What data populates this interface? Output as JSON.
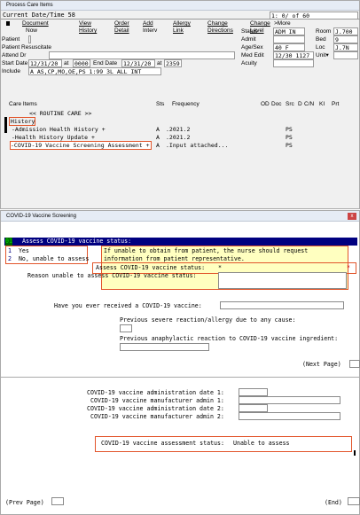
{
  "window1": {
    "title": "Process Care Items",
    "current_label": "Current Date/Time 58",
    "paging": "1: 0/ of 60",
    "menu": [
      {
        "line1": "Document",
        "line2": "Now"
      },
      {
        "line1": "View",
        "line2": "History"
      },
      {
        "line1": "Order",
        "line2": "Detail"
      },
      {
        "line1": "Add",
        "line2": "Interv"
      },
      {
        "line1": "Allergy",
        "line2": "Link"
      },
      {
        "line1": "Change",
        "line2": "Directions"
      },
      {
        "line1": "Change",
        "line2": "Level"
      },
      {
        "line1": ">More",
        "line2": ""
      }
    ],
    "left_fields": {
      "patient_label": "Patient",
      "resuscitate_label": "Patient Resuscitate",
      "attend_label": "Attend Dr",
      "start_date_label": "Start Date",
      "start_date": "12/31/20",
      "at1": "at",
      "start_time": "0000",
      "end_date_label": "End Date",
      "end_date": "12/31/20",
      "at2": "at",
      "end_time": "2359",
      "include_label": "Include",
      "include_value": "A AS,CP,MO,OE,PS 1:99 3L ALL INT"
    },
    "right_fields": {
      "status_label": "Status",
      "status_value": "ADM IN",
      "admit_label": "Admit",
      "agesex_label": "Age/Sex",
      "agesex_value": "40 F",
      "mededit_label": "Med Edit",
      "mededit_value": "12/30 1127",
      "acuity_label": "Acuity",
      "room_label": "Room",
      "room_value": "J.700",
      "bed_label": "Bed",
      "bed_value": "9",
      "loc_label": "Loc",
      "loc_value": "J.7N",
      "unit_label": "Unit▾"
    },
    "care_header": {
      "items": "Care Items",
      "sts": "Sts",
      "freq": "Frequency",
      "od": "OD",
      "doc": "Doc",
      "src": "Src",
      "d": "D",
      "cn": "C/N",
      "ki": "KI",
      "prt": "Prt"
    },
    "routine_care": "<< ROUTINE CARE >>",
    "history_label": "History",
    "care_rows": [
      {
        "name": "-Admission Health History +",
        "sts": "A",
        "freq": ".2021.2",
        "src": "PS"
      },
      {
        "name": "-Health History Update +",
        "sts": "A",
        "freq": ".2021.2",
        "src": "PS"
      },
      {
        "name": "-COVID-19 Vaccine Screening Assessment +",
        "sts": "A",
        "freq": ".Input attached...",
        "src": "PS"
      }
    ]
  },
  "window2": {
    "title": "COVID-19 Vaccine Screening",
    "close_icon": "x",
    "header_num": "01",
    "header_text": "Assess COVID-19 vaccine status:",
    "options": [
      {
        "num": "1",
        "label": "Yes"
      },
      {
        "num": "2",
        "label": "No, unable to assess"
      }
    ],
    "help_text_1": "If unable to obtain from patient, the nurse should request",
    "help_text_2": "information from patient representative.",
    "assess_label": "Assess COVID-19 vaccine status:",
    "assess_value": "*",
    "assess_marker": "*",
    "reason_label": "Reason unable to assess COVID-19 vaccine status:",
    "ever_label": "Have you ever received a COVID-19 vaccine:",
    "prev_severe_label": "Previous severe reaction/allergy due to any cause:",
    "prev_ana_label": "Previous anaphylactic reaction to COVID-19 vaccine ingredient:",
    "next_page": "(Next Page)",
    "admin_date_1": "COVID-19 vaccine administration date 1:",
    "manufacturer_1": "COVID-19 vaccine manufacturer admin 1:",
    "admin_date_2": "COVID-19 vaccine administration date 2:",
    "manufacturer_2": "COVID-19 vaccine manufacturer admin 2:",
    "assessment_status_label": "COVID-19 vaccine assessment status:",
    "assessment_status_value": "Unable to assess",
    "prev_page": "(Prev Page)",
    "end": "(End)"
  },
  "colors": {
    "highlight": "#e2552b",
    "header_bar": "#000080",
    "help_box": "#ffffc0",
    "green": "#00aa00"
  }
}
